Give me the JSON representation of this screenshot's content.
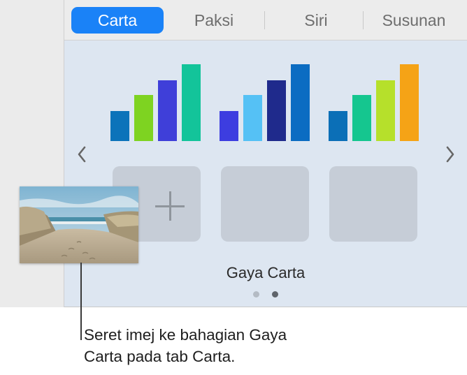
{
  "tabs": [
    {
      "label": "Carta",
      "active": true
    },
    {
      "label": "Paksi",
      "active": false
    },
    {
      "label": "Siri",
      "active": false
    },
    {
      "label": "Susunan",
      "active": false
    }
  ],
  "chart_styles": [
    {
      "bars": [
        {
          "level": 0.39,
          "color": "#0c73ba"
        },
        {
          "level": 0.6,
          "color": "#7ed321"
        },
        {
          "level": 0.79,
          "color": "#3f3fd9"
        },
        {
          "level": 1.0,
          "color": "#13c49a"
        }
      ]
    },
    {
      "bars": [
        {
          "level": 0.39,
          "color": "#3d3de0"
        },
        {
          "level": 0.6,
          "color": "#55c1f5"
        },
        {
          "level": 0.79,
          "color": "#1f2a8c"
        },
        {
          "level": 1.0,
          "color": "#0b6cc2"
        }
      ]
    },
    {
      "bars": [
        {
          "level": 0.39,
          "color": "#0b6fb7"
        },
        {
          "level": 0.6,
          "color": "#15c68f"
        },
        {
          "level": 0.79,
          "color": "#b6e02b"
        },
        {
          "level": 1.0,
          "color": "#f5a316"
        }
      ]
    }
  ],
  "icons": {
    "prev": "chevron-left-icon",
    "next": "chevron-right-icon",
    "add": "plus-icon"
  },
  "section_label": "Gaya Carta",
  "pagination": {
    "pages": 2,
    "current": 2
  },
  "colors": {
    "accent": "#1a82f7",
    "panel_bg": "#dde6f1",
    "slot_bg": "#c6cdd7"
  },
  "callout": {
    "line1": "Seret imej ke bahagian Gaya",
    "line2": "Carta pada tab Carta."
  }
}
